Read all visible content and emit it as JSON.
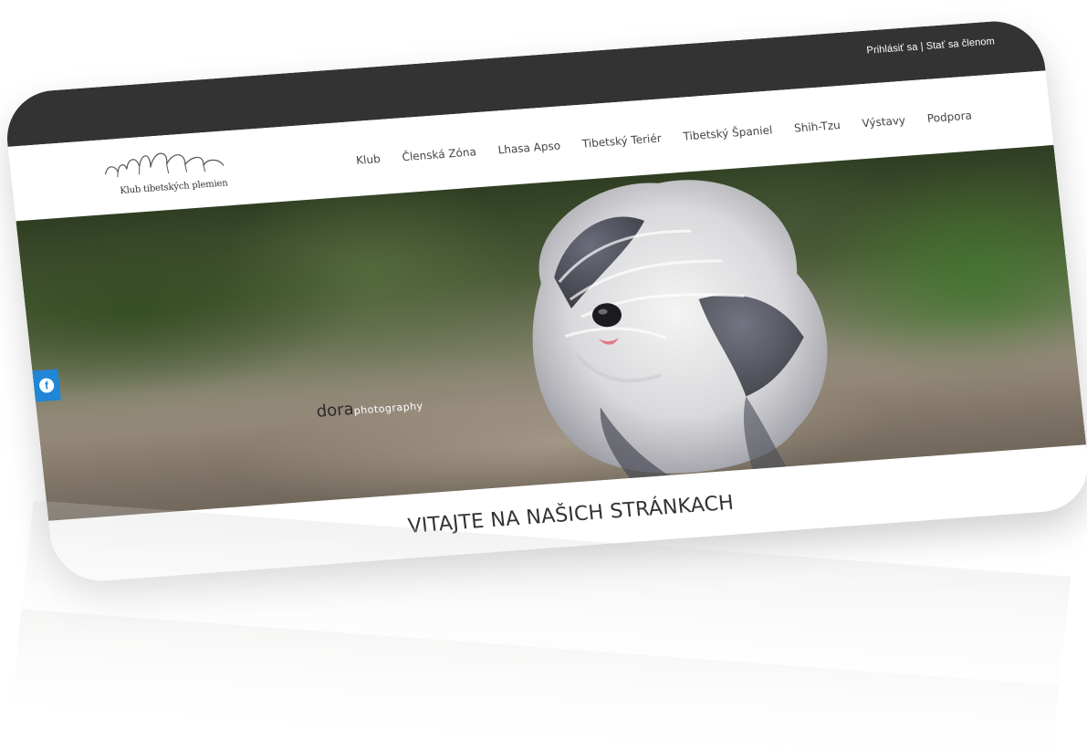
{
  "topbar": {
    "login_label": "Prihlásiť sa",
    "separator": "|",
    "join_label": "Stať sa členom",
    "background": "#333333"
  },
  "logo": {
    "text": "Klub tibetských plemien"
  },
  "nav": {
    "items": [
      {
        "label": "Klub"
      },
      {
        "label": "Členská Zóna"
      },
      {
        "label": "Lhasa Apso"
      },
      {
        "label": "Tibetský Teriér"
      },
      {
        "label": "Tibetský Španiel"
      },
      {
        "label": "Shih-Tzu"
      },
      {
        "label": "Výstavy"
      },
      {
        "label": "Podpora"
      }
    ]
  },
  "hero": {
    "watermark_mark": "dora",
    "watermark_text": "photography"
  },
  "social": {
    "facebook_icon": "facebook-icon",
    "facebook_color": "#1f86d8"
  },
  "welcome": {
    "title": "VITAJTE NA NAŠICH STRÁNKACH"
  }
}
